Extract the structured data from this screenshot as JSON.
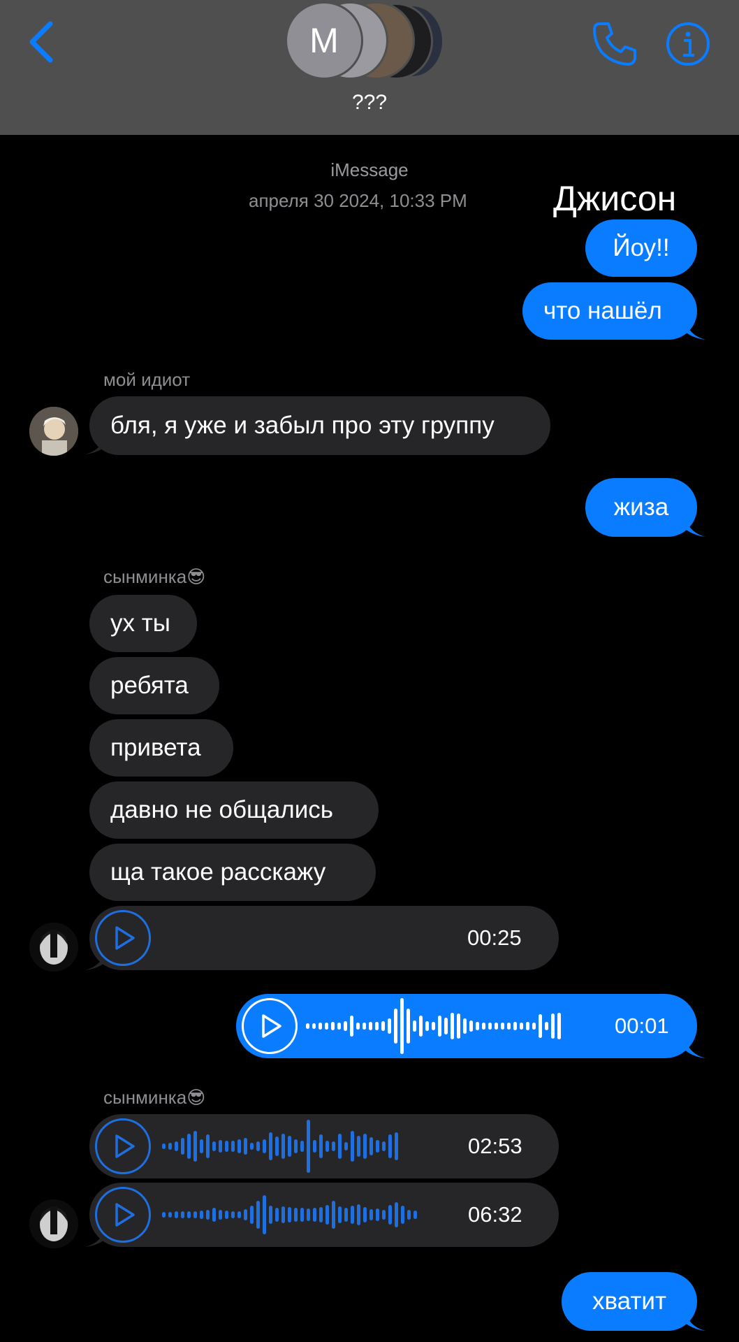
{
  "header": {
    "title": "???",
    "avatar_letter": "M",
    "accent": "#0a7cff"
  },
  "thread": {
    "service": "iMessage",
    "timestamp": "апреля 30 2024, 10:33 PM",
    "overlay_name": "Джисон"
  },
  "messages": {
    "m1": "Йоу!!",
    "m2": "что нашёл",
    "sender1": "мой идиот",
    "m3": "бля, я уже и забыл про эту группу",
    "m4": "жиза",
    "sender2": "сынминка😎",
    "m5": "ух ты",
    "m6": "ребята",
    "m7": "привета",
    "m8": "давно не общались",
    "m9": "ща такое расскажу",
    "audio1": "00:25",
    "audio2": "00:01",
    "sender3": "сынминка😎",
    "audio3": "02:53",
    "audio4": "06:32",
    "m10": "хватит"
  },
  "icons": [
    "back-chevron-icon",
    "phone-icon",
    "info-icon",
    "play-icon"
  ]
}
